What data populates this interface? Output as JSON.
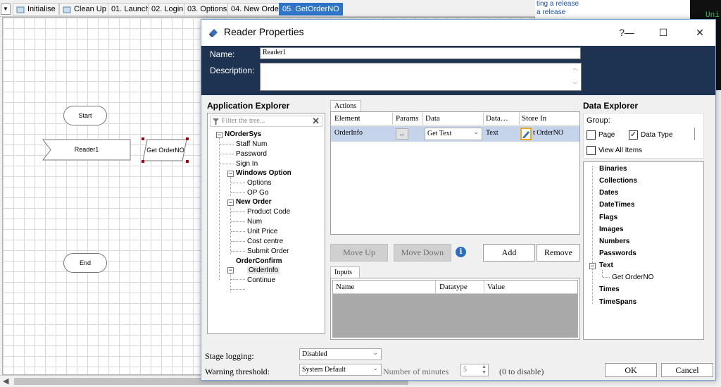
{
  "designer": {
    "tabs": [
      {
        "label": "Initialise"
      },
      {
        "label": "Clean Up"
      },
      {
        "label": "01. Launch"
      },
      {
        "label": "02. Login"
      },
      {
        "label": "03. Options"
      },
      {
        "label": "04. New Order"
      },
      {
        "label": "05. GetOrderNO"
      }
    ],
    "stages": {
      "start": "Start",
      "reader": "Reader1",
      "getorder": "Get OrderNO",
      "end": "End"
    },
    "bg_links": [
      "ting a release",
      "a release"
    ],
    "terminal_text": "Uni"
  },
  "dialog": {
    "title": "Reader Properties",
    "title_buttons": {
      "help": "?",
      "minimize": "—",
      "maximize": "☐",
      "close": "✕"
    },
    "name_label": "Name:",
    "name_value": "Reader1",
    "description_label": "Description:",
    "description_value": ""
  },
  "app_explorer": {
    "title": "Application Explorer",
    "filter_placeholder": "Filter the tree...",
    "tree": [
      {
        "label": "NOrderSys"
      },
      {
        "label": "Staff Num"
      },
      {
        "label": "Password"
      },
      {
        "label": "Sign In"
      },
      {
        "label": "Windows Option"
      },
      {
        "label": "Options"
      },
      {
        "label": "OP Go"
      },
      {
        "label": "New Order"
      },
      {
        "label": "Product Code"
      },
      {
        "label": "Num"
      },
      {
        "label": "Unit Price"
      },
      {
        "label": "Cost centre"
      },
      {
        "label": "Submit Order"
      },
      {
        "label": "OrderConfirm"
      },
      {
        "label": "OrderInfo"
      },
      {
        "label": "Continue"
      }
    ]
  },
  "actions": {
    "tab_label": "Actions",
    "columns": {
      "element": "Element",
      "params": "Params",
      "data": "Data",
      "datatype": "Data…",
      "store_in": "Store In"
    },
    "row": {
      "element": "OrderInfo",
      "params": "...",
      "data": "Get Text",
      "datatype": "Text",
      "store_in": "t OrderNO"
    },
    "buttons": {
      "move_up": "Move Up",
      "move_down": "Move Down",
      "info": "i",
      "add": "Add",
      "remove": "Remove"
    }
  },
  "inputs": {
    "tab_label": "Inputs",
    "columns": {
      "name": "Name",
      "datatype": "Datatype",
      "value": "Value"
    }
  },
  "data_explorer": {
    "title": "Data Explorer",
    "group_label": "Group:",
    "page_label": "Page",
    "page_checked": false,
    "datatype_label": "Data Type",
    "datatype_checked": true,
    "view_all_label": "View All Items",
    "view_all_checked": false,
    "items": {
      "binaries": "Binaries",
      "collections": "Collections",
      "dates": "Dates",
      "datetimes": "DateTimes",
      "flags": "Flags",
      "images": "Images",
      "numbers": "Numbers",
      "passwords": "Passwords",
      "text": "Text",
      "text_child": "Get OrderNO",
      "times": "Times",
      "timespans": "TimeSpans"
    }
  },
  "footer": {
    "stage_logging_label": "Stage logging:",
    "stage_logging_value": "Disabled",
    "warning_label": "Warning threshold:",
    "warning_value": "System Default",
    "minutes_label": "Number of minutes",
    "minutes_value": "5",
    "disable_hint": "(0 to disable)",
    "ok": "OK",
    "cancel": "Cancel"
  },
  "colors": {
    "header_bg": "#1e3352",
    "tab_active": "#2e74c8",
    "row_selected": "#c5d4ea",
    "store_icon_border": "#f2a71b"
  }
}
